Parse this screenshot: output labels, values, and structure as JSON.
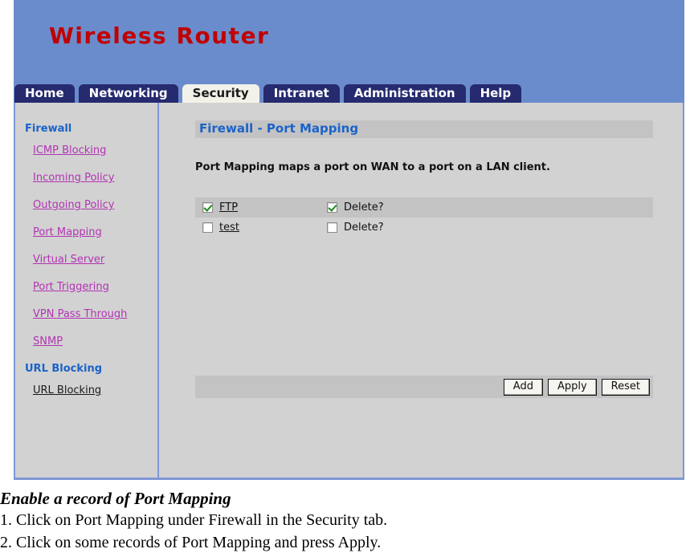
{
  "brand": {
    "title": "Wireless Router",
    "title_color": "#c00000",
    "banner_color": "#6b8ccc"
  },
  "tabs": [
    {
      "label": "Home",
      "active": false
    },
    {
      "label": "Networking",
      "active": false
    },
    {
      "label": "Security",
      "active": true
    },
    {
      "label": "Intranet",
      "active": false
    },
    {
      "label": "Administration",
      "active": false
    },
    {
      "label": "Help",
      "active": false
    }
  ],
  "sidebar": {
    "groups": [
      {
        "title": "Firewall",
        "items": [
          {
            "label": "ICMP Blocking",
            "visited": false
          },
          {
            "label": "Incoming Policy",
            "visited": false
          },
          {
            "label": "Outgoing Policy",
            "visited": false
          },
          {
            "label": "Port Mapping",
            "visited": false
          },
          {
            "label": "Virtual Server",
            "visited": false
          },
          {
            "label": "Port Triggering",
            "visited": false
          },
          {
            "label": "VPN Pass Through",
            "visited": false
          },
          {
            "label": "SNMP",
            "visited": false
          }
        ]
      },
      {
        "title": "URL Blocking",
        "items": [
          {
            "label": "URL Blocking",
            "visited": true
          }
        ]
      }
    ]
  },
  "content": {
    "section_title": "Firewall - Port Mapping",
    "section_title_color": "#1a63c9",
    "description": "Port Mapping maps a port on WAN to a port on a LAN client.",
    "delete_label": "Delete?",
    "records": [
      {
        "name": "FTP",
        "enabled": true,
        "delete": true
      },
      {
        "name": "test",
        "enabled": false,
        "delete": false
      }
    ],
    "buttons": [
      {
        "label": "Add"
      },
      {
        "label": "Apply"
      },
      {
        "label": "Reset"
      }
    ]
  },
  "caption": {
    "heading": "Enable a record of Port Mapping",
    "steps": [
      "1. Click on Port Mapping under Firewall in the Security tab.",
      "2. Click on some records of Port Mapping and press Apply."
    ]
  }
}
